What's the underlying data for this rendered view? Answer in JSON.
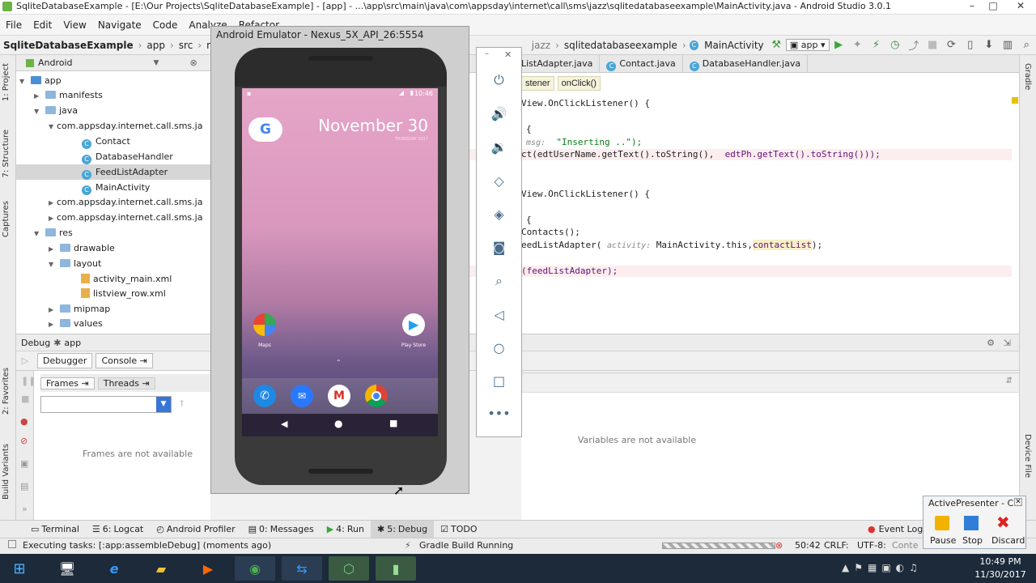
{
  "window": {
    "title": "SqliteDatabaseExample - [E:\\Our Projects\\SqliteDatabaseExample] - [app] - ...\\app\\src\\main\\java\\com\\appsday\\internet\\call\\sms\\jazz\\sqlitedatabaseexample\\MainActivity.java - Android Studio 3.0.1"
  },
  "menu": [
    "File",
    "Edit",
    "View",
    "Navigate",
    "Code",
    "Analyze",
    "Refactor"
  ],
  "nav": {
    "project": "SqliteDatabaseExample",
    "module": "app",
    "src": "src",
    "main": "main",
    "jazz_partial": "jazz",
    "pkg": "sqlitedatabaseexample",
    "cls": "MainActivity",
    "run_config": "app"
  },
  "project_panel": {
    "view": "Android",
    "items": [
      {
        "label": "app"
      },
      {
        "label": "manifests"
      },
      {
        "label": "java"
      },
      {
        "label": "com.appsday.internet.call.sms.ja"
      },
      {
        "label": "Contact"
      },
      {
        "label": "DatabaseHandler"
      },
      {
        "label": "FeedListAdapter"
      },
      {
        "label": "MainActivity"
      },
      {
        "label": "com.appsday.internet.call.sms.ja"
      },
      {
        "label": "com.appsday.internet.call.sms.ja"
      },
      {
        "label": "res"
      },
      {
        "label": "drawable"
      },
      {
        "label": "layout"
      },
      {
        "label": "activity_main.xml"
      },
      {
        "label": "listview_row.xml"
      },
      {
        "label": "mipmap"
      },
      {
        "label": "values"
      }
    ]
  },
  "editor_tabs": [
    "ListAdapter.java",
    "Contact.java",
    "DatabaseHandler.java"
  ],
  "editor": {
    "crumb1": "stener",
    "crumb2": "onClick()",
    "line1": "View.OnClickListener() {",
    "line2": "{",
    "line3_hint": "msg:",
    "line3_str": "\"Inserting ..\");",
    "line4a": "ct(edtUserName.getText().toString(),",
    "line4b": "edtPh.getText().toString()));",
    "line5": "View.OnClickListener() {",
    "line6": "{",
    "line7": "Contacts();",
    "line8a": "eedListAdapter(",
    "line8_hint": "activity:",
    "line8b": "MainActivity.this,",
    "line8c": "contactList",
    "line8d": ");",
    "line9": "(feedListAdapter);"
  },
  "debug": {
    "label": "Debug",
    "config": "app",
    "tab_debugger": "Debugger",
    "tab_console": "Console",
    "frames": "Frames",
    "threads": "Threads",
    "frames_empty": "Frames are not available",
    "vars_empty": "Variables are not available"
  },
  "left_tabs": [
    "1: Project",
    "7: Structure",
    "Captures",
    "2: Favorites",
    "Build Variants"
  ],
  "right_tabs": [
    "Gradle",
    "Device File"
  ],
  "emulator": {
    "title": "Android Emulator - Nexus_5X_API_26:5554",
    "time": "10:46",
    "date": "November 30",
    "sub": "THURSDAY 2017",
    "google_letter": "G",
    "maps": "Maps",
    "play": "Play Store"
  },
  "tool_windows": [
    {
      "label": "Terminal",
      "num": ""
    },
    {
      "label": "Logcat",
      "num": "6: "
    },
    {
      "label": "Android Profiler",
      "num": ""
    },
    {
      "label": "Messages",
      "num": "0: "
    },
    {
      "label": "Run",
      "num": "4: "
    },
    {
      "label": "Debug",
      "num": "5: "
    },
    {
      "label": "TODO",
      "num": ""
    }
  ],
  "event_log": "Event Log",
  "status": {
    "task": "Executing tasks: [:app:assembleDebug] (moments ago)",
    "gradle": "Gradle Build Running",
    "pos": "50:42",
    "crlf": "CRLF:",
    "enc": "UTF-8:",
    "ctx": "Conte"
  },
  "activepresenter": {
    "title": "ActivePresenter - C...",
    "pause": "Pause",
    "stop": "Stop",
    "discard": "Discard"
  },
  "clock": {
    "time": "10:49 PM",
    "date": "11/30/2017"
  },
  "colors": {
    "accent": "#3875d7",
    "play": "#38a838",
    "stop": "#d33"
  }
}
